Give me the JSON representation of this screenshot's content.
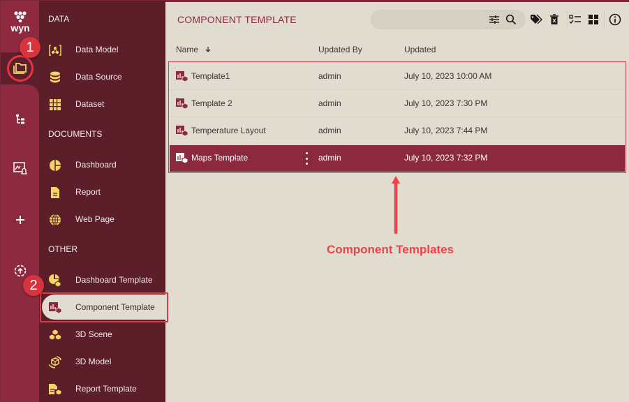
{
  "app": {
    "logo_text": "wyn",
    "accent_color": "#8b2a3e",
    "sidebar_color": "#5c1f2a",
    "icon_color": "#f2d565",
    "annotation_color": "#e8353f"
  },
  "rail": {
    "items": [
      {
        "name": "documents-folder",
        "icon": "folder-icon",
        "active": true
      },
      {
        "name": "hierarchy",
        "icon": "tree-icon"
      },
      {
        "name": "monitor",
        "icon": "image-alert-icon"
      },
      {
        "name": "create",
        "icon": "plus-icon"
      },
      {
        "name": "upload",
        "icon": "upload-circle-icon"
      }
    ]
  },
  "badges": {
    "one": "1",
    "two": "2"
  },
  "nav": {
    "sections": [
      {
        "label": "DATA",
        "items": [
          {
            "label": "Data Model",
            "icon": "data-model-icon"
          },
          {
            "label": "Data Source",
            "icon": "database-icon"
          },
          {
            "label": "Dataset",
            "icon": "grid-icon"
          }
        ]
      },
      {
        "label": "DOCUMENTS",
        "items": [
          {
            "label": "Dashboard",
            "icon": "pie-chart-icon"
          },
          {
            "label": "Report",
            "icon": "document-icon"
          },
          {
            "label": "Web Page",
            "icon": "globe-icon"
          }
        ]
      },
      {
        "label": "OTHER",
        "items": [
          {
            "label": "Dashboard Template",
            "icon": "dashboard-template-icon"
          },
          {
            "label": "Component Template",
            "icon": "component-template-icon",
            "selected": true
          },
          {
            "label": "3D Scene",
            "icon": "cubes-icon"
          },
          {
            "label": "3D Model",
            "icon": "rotate-cube-icon"
          },
          {
            "label": "Report Template",
            "icon": "report-template-icon"
          }
        ]
      }
    ]
  },
  "main": {
    "title": "COMPONENT TEMPLATE",
    "search": {
      "placeholder": "",
      "value": ""
    },
    "toolbar": [
      "filter-settings-icon",
      "search-icon",
      "tag-icon",
      "recycle-bin-icon",
      "checklist-icon",
      "grid-view-icon",
      "info-icon"
    ],
    "columns": [
      {
        "label": "Name",
        "sort": "desc"
      },
      {
        "label": "Updated By"
      },
      {
        "label": "Updated"
      }
    ],
    "rows": [
      {
        "name": "Template1",
        "updated_by": "admin",
        "updated": "July 10, 2023 10:00 AM",
        "selected": false
      },
      {
        "name": "Template 2",
        "updated_by": "admin",
        "updated": "July 10, 2023 7:30 PM",
        "selected": false
      },
      {
        "name": "Temperature Layout",
        "updated_by": "admin",
        "updated": "July 10, 2023 7:44 PM",
        "selected": false
      },
      {
        "name": "Maps Template",
        "updated_by": "admin",
        "updated": "July 10, 2023 7:32 PM",
        "selected": true
      }
    ],
    "annotation": "Component Templates"
  }
}
